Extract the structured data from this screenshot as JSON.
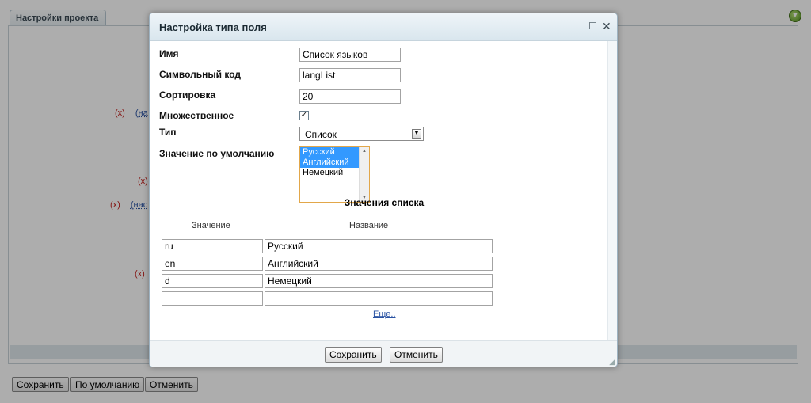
{
  "background": {
    "tab_label": "Настройки проекта",
    "links": [
      {
        "x": "(x)",
        "n": "(на"
      },
      {
        "x": "(x)",
        "n": ""
      },
      {
        "x": "(x)",
        "n": "(нас"
      },
      {
        "x": "(x)",
        "n": ""
      }
    ],
    "buttons": {
      "save": "Сохранить",
      "default": "По умолчанию",
      "cancel": "Отменить"
    }
  },
  "dialog": {
    "title": "Настройка типа поля",
    "fields": {
      "name_label": "Имя",
      "name_value": "Список языков",
      "code_label": "Символьный код",
      "code_value": "langList",
      "sort_label": "Сортировка",
      "sort_value": "20",
      "multiple_label": "Множественное",
      "multiple_checked": true,
      "type_label": "Тип",
      "type_value": "Список",
      "default_label": "Значение по умолчанию",
      "default_options": [
        {
          "label": "Русский",
          "selected": true
        },
        {
          "label": "Английский",
          "selected": true
        },
        {
          "label": "Немецкий",
          "selected": false
        }
      ]
    },
    "list_section": {
      "title": "Значения списка",
      "col_value": "Значение",
      "col_name": "Название",
      "rows": [
        {
          "value": "ru",
          "name": "Русский"
        },
        {
          "value": "en",
          "name": "Английский"
        },
        {
          "value": "d",
          "name": "Немецкий"
        },
        {
          "value": "",
          "name": ""
        }
      ],
      "more_link": "Еще.."
    },
    "buttons": {
      "save": "Сохранить",
      "cancel": "Отменить"
    }
  },
  "colors": {
    "accent": "#3399ff",
    "focus_border": "#e2a74a",
    "link": "#2a53a3",
    "remove": "#c5221f"
  }
}
